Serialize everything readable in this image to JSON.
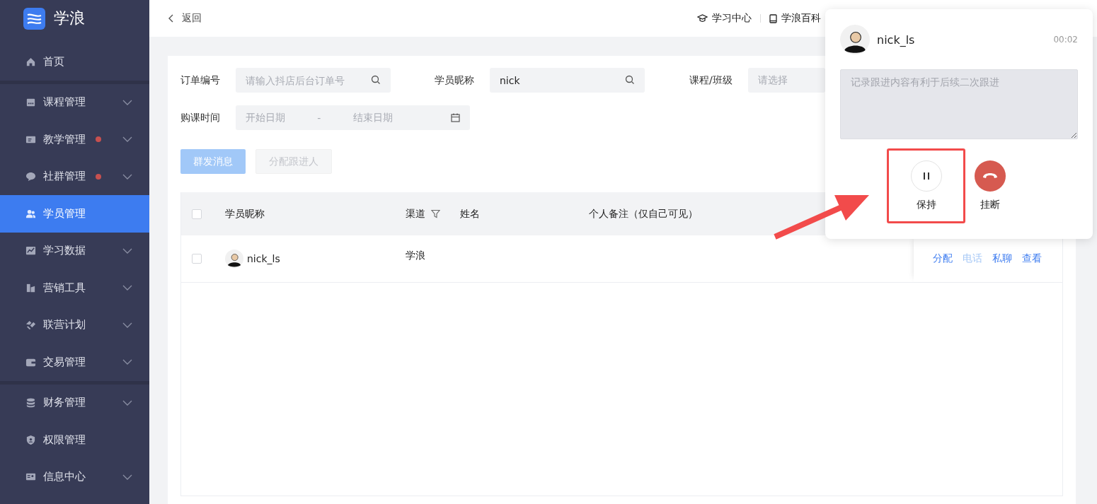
{
  "logo": {
    "text": "学浪"
  },
  "sidebar": {
    "sections": [
      [
        {
          "label": "首页",
          "expandable": false,
          "badge": false,
          "selected": false
        }
      ],
      [
        {
          "label": "课程管理",
          "expandable": true,
          "badge": false,
          "selected": false
        },
        {
          "label": "教学管理",
          "expandable": true,
          "badge": true,
          "selected": false
        },
        {
          "label": "社群管理",
          "expandable": true,
          "badge": true,
          "selected": false
        },
        {
          "label": "学员管理",
          "expandable": false,
          "badge": false,
          "selected": true
        },
        {
          "label": "学习数据",
          "expandable": true,
          "badge": false,
          "selected": false
        },
        {
          "label": "营销工具",
          "expandable": true,
          "badge": false,
          "selected": false
        },
        {
          "label": "联营计划",
          "expandable": true,
          "badge": false,
          "selected": false
        },
        {
          "label": "交易管理",
          "expandable": true,
          "badge": false,
          "selected": false
        }
      ],
      [
        {
          "label": "财务管理",
          "expandable": true,
          "badge": false,
          "selected": false
        },
        {
          "label": "权限管理",
          "expandable": false,
          "badge": false,
          "selected": false
        },
        {
          "label": "信息中心",
          "expandable": true,
          "badge": false,
          "selected": false
        }
      ]
    ]
  },
  "topbar": {
    "back": "返回",
    "links": [
      "学习中心",
      "学浪百科"
    ]
  },
  "filters": [
    {
      "label": "订单编号",
      "kind": "search",
      "placeholder": "请输入抖店后台订单号"
    },
    {
      "label": "学员昵称",
      "kind": "search",
      "value": "nick"
    },
    {
      "label": "课程/班级",
      "kind": "select",
      "placeholder": "请选择"
    },
    {
      "label": "购课时间",
      "kind": "daterange",
      "placeholder": "开始日期",
      "separator": "-",
      "placeholder_end": "结束日期"
    }
  ],
  "buttons": [
    {
      "label": "群发消息",
      "kind": "primary",
      "disabled": true
    },
    {
      "label": "分配跟进人",
      "kind": "default",
      "disabled": true
    }
  ],
  "table": {
    "header_checked": false,
    "columns": [
      {
        "label": "学员昵称",
        "filter": false
      },
      {
        "label": "渠道",
        "filter": true
      },
      {
        "label": "姓名",
        "filter": false
      },
      {
        "label": "个人备注（仅自己可见）",
        "filter": false
      }
    ],
    "rows": [
      {
        "checked": false,
        "nickname": "nick_ls",
        "channel": "学浪",
        "actions": [
          {
            "label": "分配",
            "disabled": false
          },
          {
            "label": "电话",
            "disabled": true
          },
          {
            "label": "私聊",
            "disabled": false
          },
          {
            "label": "查看",
            "disabled": false
          }
        ]
      }
    ]
  },
  "call": {
    "name": "nick_ls",
    "timer": "00:02",
    "placeholder": "记录跟进内容有利于后续二次跟进",
    "controls": [
      {
        "label": "保持",
        "kind": "hold",
        "highlighted": true
      },
      {
        "label": "挂断",
        "kind": "hangup",
        "highlighted": false
      }
    ]
  }
}
